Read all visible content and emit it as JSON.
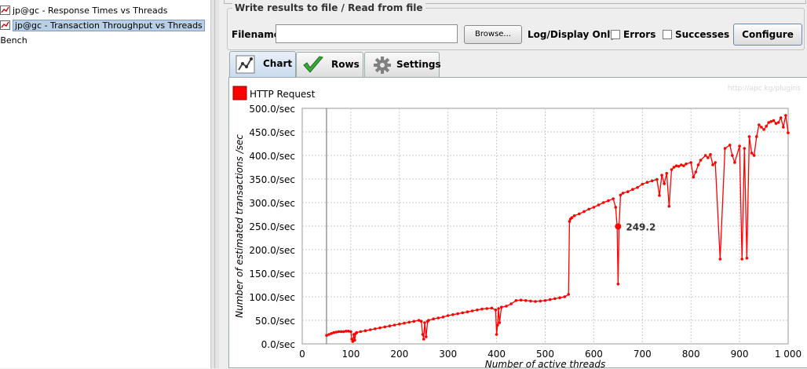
{
  "tree": {
    "items": [
      {
        "label": "jp@gc - Response Times vs Threads",
        "selected": false
      },
      {
        "label": "jp@gc - Transaction Throughput vs Threads",
        "selected": true
      },
      {
        "label": "kBench",
        "selected": false
      }
    ]
  },
  "file_panel": {
    "legend": "Write results to file / Read from file",
    "filename_label": "Filename",
    "filename_value": "",
    "browse_label": "Browse...",
    "log_display_label": "Log/Display Only:",
    "errors_label": "Errors",
    "successes_label": "Successes",
    "configure_label": "Configure"
  },
  "tabs": [
    {
      "label": "Chart",
      "icon": "chart-icon",
      "active": true
    },
    {
      "label": "Rows",
      "icon": "checkmark-icon",
      "active": false
    },
    {
      "label": "Settings",
      "icon": "gear-icon",
      "active": false
    }
  ],
  "colors": {
    "series": "#ff0000",
    "grid": "#c8c8c8",
    "tab_active": "#c9dbee"
  },
  "chart_data": {
    "type": "line",
    "watermark": "http://apc.kg/plugins",
    "legend_placement": "top-left",
    "xlabel": "Number of active threads",
    "ylabel": "Number of estimated transactions /sec",
    "xlim": [
      0,
      1000
    ],
    "ylim": [
      0,
      500
    ],
    "x_ticks": [
      "0",
      "100",
      "200",
      "300",
      "400",
      "500",
      "600",
      "700",
      "800",
      "900",
      "1 000"
    ],
    "y_ticks": [
      "0.0/sec",
      "50.0/sec",
      "100.0/sec",
      "150.0/sec",
      "200.0/sec",
      "250.0/sec",
      "300.0/sec",
      "350.0/sec",
      "400.0/sec",
      "450.0/sec",
      "500.0/sec"
    ],
    "grid": true,
    "annotation": {
      "x": 650,
      "y": 249.2,
      "label": "249.2"
    },
    "series": [
      {
        "name": "HTTP Request",
        "x": [
          50,
          55,
          60,
          65,
          70,
          75,
          80,
          85,
          90,
          95,
          100,
          102,
          104,
          106,
          108,
          110,
          112,
          120,
          130,
          140,
          150,
          160,
          170,
          180,
          190,
          200,
          210,
          220,
          230,
          240,
          245,
          248,
          250,
          252,
          255,
          258,
          260,
          270,
          280,
          290,
          300,
          310,
          320,
          330,
          340,
          350,
          360,
          370,
          380,
          390,
          398,
          400,
          402,
          404,
          406,
          410,
          420,
          430,
          440,
          450,
          460,
          470,
          480,
          490,
          500,
          510,
          520,
          530,
          540,
          548,
          550,
          552,
          555,
          560,
          570,
          580,
          590,
          600,
          610,
          620,
          630,
          640,
          645,
          648,
          650,
          652,
          655,
          660,
          670,
          680,
          690,
          700,
          710,
          720,
          730,
          735,
          740,
          745,
          750,
          755,
          760,
          765,
          770,
          775,
          780,
          785,
          790,
          800,
          805,
          810,
          815,
          820,
          830,
          835,
          840,
          845,
          850,
          860,
          870,
          880,
          885,
          890,
          900,
          905,
          910,
          915,
          920,
          925,
          930,
          935,
          940,
          945,
          950,
          955,
          960,
          965,
          970,
          975,
          980,
          985,
          990,
          995,
          1000
        ],
        "y": [
          18,
          20,
          22,
          24,
          25,
          26,
          26,
          26,
          27,
          27,
          26,
          10,
          5,
          20,
          8,
          22,
          24,
          26,
          28,
          30,
          32,
          34,
          36,
          38,
          40,
          42,
          44,
          46,
          48,
          50,
          48,
          20,
          10,
          45,
          15,
          48,
          50,
          53,
          55,
          57,
          60,
          62,
          64,
          66,
          68,
          70,
          72,
          74,
          75,
          76,
          72,
          20,
          40,
          75,
          45,
          78,
          80,
          85,
          92,
          93,
          92,
          91,
          90,
          91,
          92,
          94,
          96,
          98,
          100,
          105,
          260,
          265,
          268,
          272,
          276,
          281,
          286,
          290,
          295,
          300,
          304,
          308,
          290,
          250,
          127,
          248,
          316,
          320,
          323,
          328,
          332,
          339,
          343,
          346,
          349,
          315,
          358,
          340,
          362,
          292,
          370,
          375,
          378,
          377,
          380,
          378,
          382,
          385,
          354,
          365,
          380,
          390,
          400,
          395,
          402,
          380,
          385,
          180,
          415,
          422,
          400,
          385,
          420,
          180,
          415,
          182,
          440,
          405,
          400,
          440,
          465,
          460,
          455,
          462,
          470,
          472,
          474,
          468,
          470,
          480,
          460,
          485,
          448
        ]
      }
    ]
  }
}
